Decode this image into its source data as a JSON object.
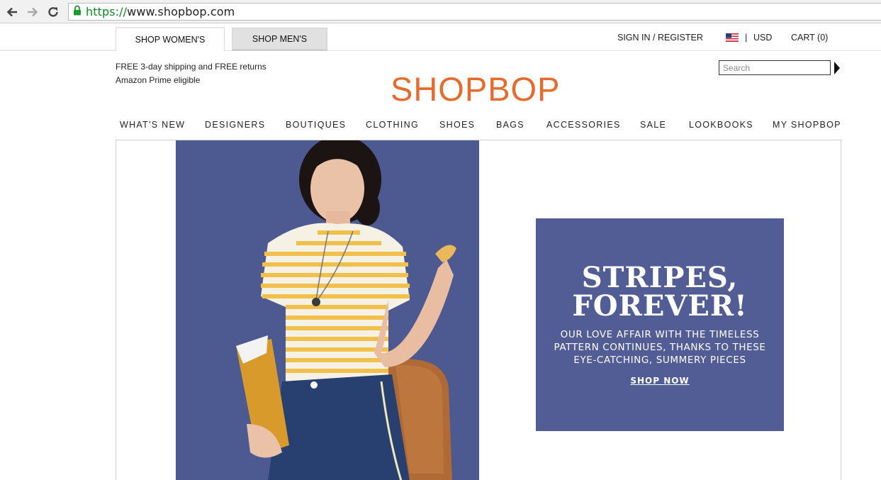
{
  "browser": {
    "url_scheme": "https://",
    "url_rest": "www.shopbop.com"
  },
  "topbar": {
    "tab_women": "SHOP WOMEN'S",
    "tab_men": "SHOP MEN'S",
    "sign_in": "SIGN IN / REGISTER",
    "currency_sep": "|",
    "currency": "USD",
    "cart": "CART (0)"
  },
  "header": {
    "promo_line1": "FREE 3-day shipping and FREE returns",
    "promo_line2": "Amazon Prime eligible",
    "logo": "SHOPBOP",
    "search_placeholder": "Search"
  },
  "nav": {
    "items": [
      "WHAT'S NEW",
      "DESIGNERS",
      "BOUTIQUES",
      "CLOTHING",
      "SHOES",
      "BAGS",
      "ACCESSORIES",
      "SALE",
      "LOOKBOOKS",
      "MY SHOPBOP"
    ]
  },
  "hero": {
    "headline_line1": "STRIPES,",
    "headline_line2": "FOREVER!",
    "sub_line1": "OUR LOVE AFFAIR WITH THE TIMELESS",
    "sub_line2": "PATTERN CONTINUES, THANKS TO THESE",
    "sub_line3": "EYE-CATCHING, SUMMERY PIECES",
    "cta": "SHOP NOW"
  },
  "colors": {
    "brand_orange": "#e56c2e",
    "promo_blue": "#525d96",
    "photo_blue": "#4d5a92"
  }
}
